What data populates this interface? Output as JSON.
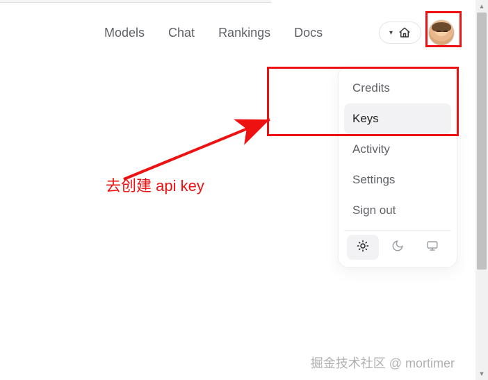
{
  "nav": {
    "items": [
      "Models",
      "Chat",
      "Rankings",
      "Docs"
    ]
  },
  "dropdown": {
    "items": [
      "Credits",
      "Keys",
      "Activity",
      "Settings",
      "Sign out"
    ],
    "active_index": 1
  },
  "theme": {
    "options": [
      "light",
      "dark",
      "system"
    ],
    "active_index": 0
  },
  "annotation": {
    "text": "去创建 api  key"
  },
  "watermark": {
    "text": "掘金技术社区 @ mortimer"
  },
  "colors": {
    "highlight": "#e11",
    "nav_text": "#5e6166",
    "menu_active_bg": "#f2f2f4"
  }
}
